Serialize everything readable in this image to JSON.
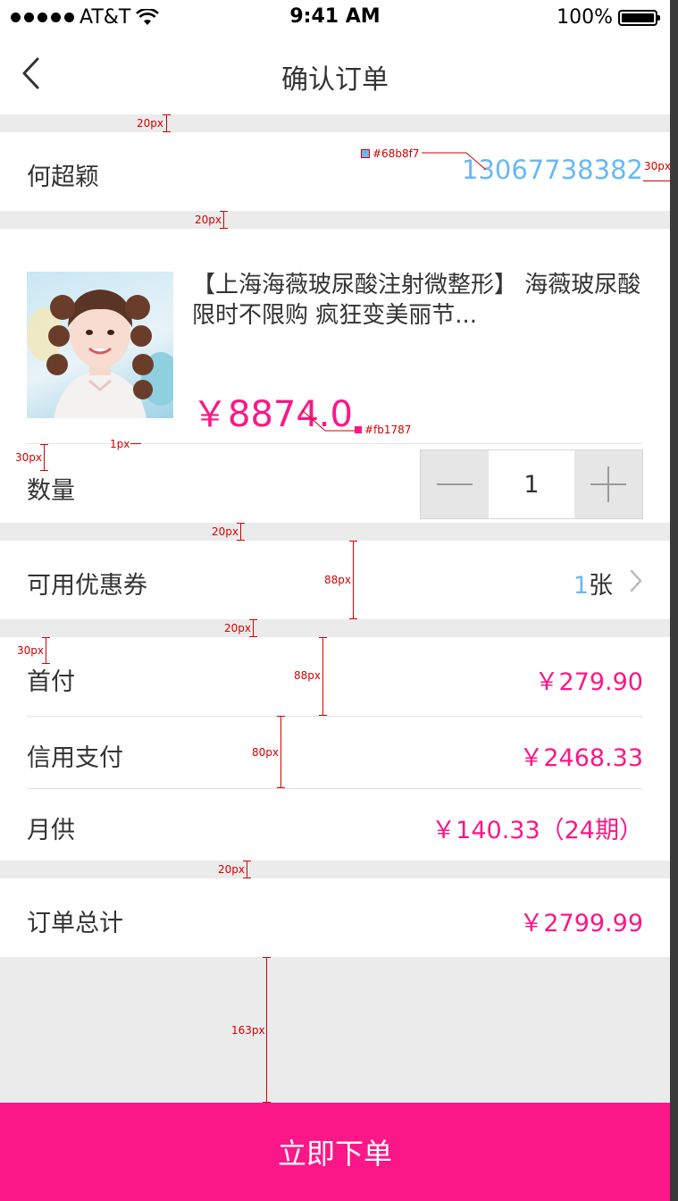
{
  "status_bar": {
    "carrier": "AT&T",
    "time": "9:41 AM",
    "battery": "100%"
  },
  "nav": {
    "title": "确认订单"
  },
  "contact": {
    "name": "何超颖",
    "phone": "13067738382"
  },
  "product": {
    "name": "【上海海薇玻尿酸注射微整形】 海薇玻尿酸 限时不限购 疯狂变美丽节...",
    "price": "￥8874.0",
    "quantity_label": "数量",
    "quantity": "1"
  },
  "coupon": {
    "label": "可用优惠券",
    "count": "1",
    "unit": "张"
  },
  "payment": {
    "down_payment_label": "首付",
    "down_payment": "￥279.90",
    "credit_label": "信用支付",
    "credit": "￥2468.33",
    "monthly_label": "月供",
    "monthly": "￥140.33（24期）"
  },
  "total": {
    "label": "订单总计",
    "value": "￥2799.99"
  },
  "submit_label": "立即下单",
  "annotations": {
    "gap20": "20px",
    "margin30": "30px",
    "h88": "88px",
    "h80": "80px",
    "h163": "163px",
    "px1": "1px",
    "color_blue": "#68b8f7",
    "color_pink": "#fb1787"
  },
  "colors": {
    "accent": "#fb1787",
    "phone": "#68b8f7",
    "background": "#ebebeb"
  }
}
